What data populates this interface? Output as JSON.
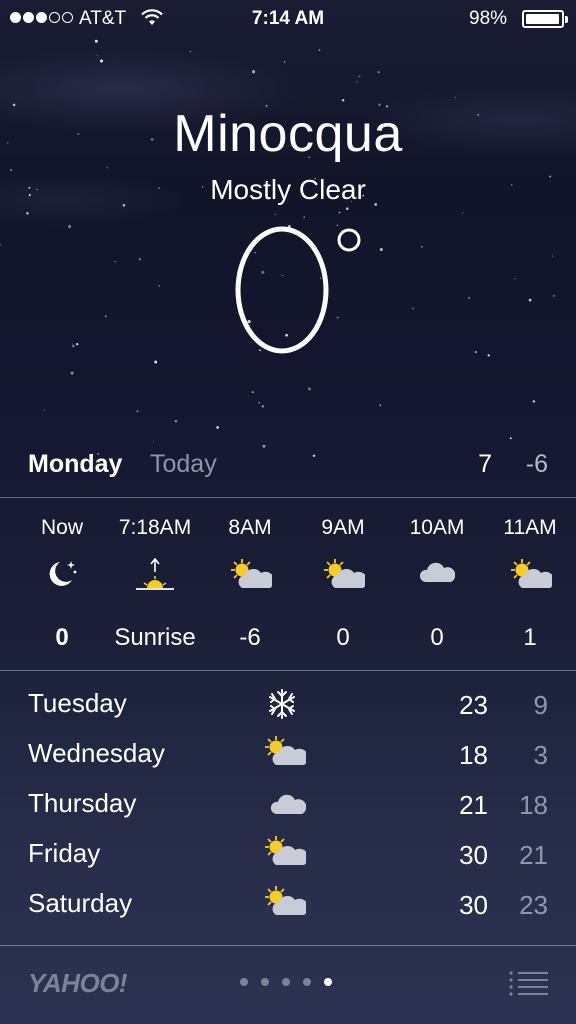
{
  "status_bar": {
    "carrier": "AT&T",
    "time": "7:14 AM",
    "battery": "98%",
    "signal_bars": 3,
    "signal_total": 5
  },
  "header": {
    "city": "Minocqua",
    "condition": "Mostly Clear",
    "temperature": "0",
    "degree_symbol": "°"
  },
  "today": {
    "day": "Monday",
    "label": "Today",
    "high": "7",
    "low": "-6"
  },
  "hourly": [
    {
      "time": "Now",
      "icon": "moon-stars-icon",
      "value": "0"
    },
    {
      "time": "7:18AM",
      "icon": "sunrise-icon",
      "value": "Sunrise"
    },
    {
      "time": "8AM",
      "icon": "partly-cloudy-icon",
      "value": "-6"
    },
    {
      "time": "9AM",
      "icon": "partly-cloudy-icon",
      "value": "0"
    },
    {
      "time": "10AM",
      "icon": "cloud-icon",
      "value": "0"
    },
    {
      "time": "11AM",
      "icon": "partly-cloudy-icon",
      "value": "1"
    }
  ],
  "daily": [
    {
      "day": "Tuesday",
      "icon": "snowflake-icon",
      "high": "23",
      "low": "9"
    },
    {
      "day": "Wednesday",
      "icon": "partly-cloudy-icon",
      "high": "18",
      "low": "3"
    },
    {
      "day": "Thursday",
      "icon": "cloud-icon",
      "high": "21",
      "low": "18"
    },
    {
      "day": "Friday",
      "icon": "partly-cloudy-icon",
      "high": "30",
      "low": "21"
    },
    {
      "day": "Saturday",
      "icon": "partly-cloudy-icon",
      "high": "30",
      "low": "23"
    }
  ],
  "footer": {
    "logo": "YAHOO!",
    "pages_total": 5,
    "active_page": 5
  },
  "colors": {
    "sun_yellow": "#f5cc2a",
    "cloud_gray": "#c9ccd6",
    "muted_text": "#8f95a8"
  }
}
